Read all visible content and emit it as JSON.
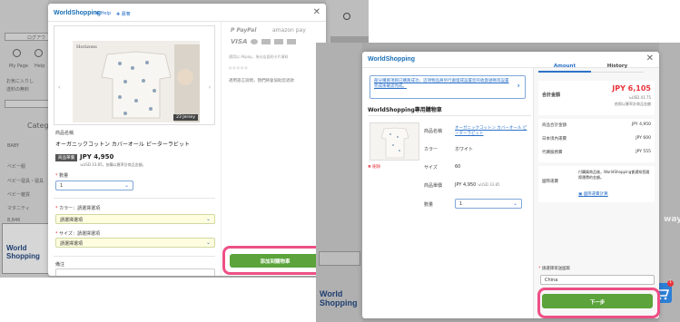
{
  "left_shot": {
    "bg": {
      "login": "ログアウ",
      "my_page": "My Page",
      "help": "Help",
      "favorites": "お気に入りし",
      "shipping_note": "送料の無料",
      "category": "Categor",
      "baby": "BABY",
      "side_items": [
        "ベビー服",
        "ベビー寝具・寝具",
        "ベビー雑貨",
        "マタニティ"
      ],
      "items_count": "8,846",
      "cart_count": "1"
    },
    "modal": {
      "logo": "WorldShopping",
      "help": "Help",
      "nav_link": "募奪",
      "product_section_label": "商品名稱",
      "product_name": "オーガニックコットン カバーオール ピーターラビット",
      "price_badge": "商品單價",
      "price": "JPY 4,950",
      "price_sub": "≒USD 33.85，依購以匯率計商品金額。",
      "qty_label": "數量",
      "qty_value": "1",
      "color_label": "カラー：請選擇選項",
      "color_value": "請選擇選項",
      "size_label": "サイズ：請選擇選項",
      "size_value": "請選擇選項",
      "note_label": "備注",
      "payment_note": "適用以 Alipay，為分店面的卡片資料",
      "support_note": "適用語言說明，我們將會協助您退款",
      "cta": "添加到購物車",
      "image_caption": "23 Jersey"
    }
  },
  "right_shot": {
    "bg": {
      "away_text": "way",
      "cart_count": "1"
    },
    "modal": {
      "logo": "WorldShopping",
      "banner_text": "部分購買項目已購買成功，這項物品將另行處理或設置您的收貨號碼等設置完成後確認完成。",
      "cart_title": "WorldShopping專用購物車",
      "product_label": "商品名稱",
      "product_name": "オーガニックコットン カバーオール ピーターラビット",
      "color_label": "カラー",
      "color_value": "ホワイト",
      "size_label": "サイズ",
      "size_value": "60",
      "price_label": "商品單價",
      "price_value": "JPY 4,950",
      "price_usd": "≒USD 33.85",
      "qty_label": "數量",
      "qty_value": "1",
      "delete_label": "刪除",
      "tabs": [
        "Amount",
        "History"
      ],
      "total_label": "合計金額",
      "total_value": "JPY 6,105",
      "total_usd": "≒USD 41.75",
      "total_note": "依照以匯率計商品金額",
      "rows": [
        {
          "label": "商品合計金額",
          "value": "JPY 4,950"
        },
        {
          "label": "日本境內運費",
          "value": "JPY 600"
        },
        {
          "label": "代購服務費",
          "value": "JPY 555"
        }
      ],
      "intl_label": "國際運費",
      "intl_note": "付購買商品後，WorldShopping會通知您國際運費的金額。",
      "intl_link": "國際運費計算",
      "country_label": "請選擇寄送國家",
      "country_value": "China",
      "next_btn": "下一步"
    }
  },
  "colors": {
    "brand": "#1a6fb5",
    "green": "#5ba33a",
    "highlight": "#ee4f86",
    "price_red": "#e8343b"
  }
}
